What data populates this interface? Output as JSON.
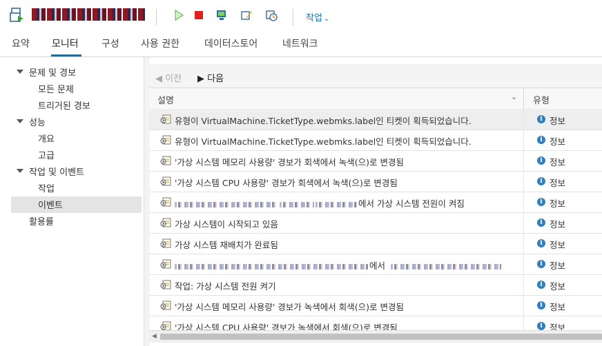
{
  "toolbar": {
    "vm_icon": "vm-power-icon",
    "icons": [
      "play-icon",
      "stop-icon",
      "console-icon",
      "edit-settings-icon",
      "snapshot-icon"
    ],
    "actions_label": "작업"
  },
  "tabs": [
    {
      "label": "요약"
    },
    {
      "label": "모니터"
    },
    {
      "label": "구성"
    },
    {
      "label": "사용 권한"
    },
    {
      "label": "데이터스토어"
    },
    {
      "label": "네트워크"
    }
  ],
  "active_tab": "모니터",
  "sidebar": {
    "groups": [
      {
        "label": "문제 및 경보",
        "items": [
          "모든 문제",
          "트리거된 경보"
        ]
      },
      {
        "label": "성능",
        "items": [
          "개요",
          "고급"
        ]
      },
      {
        "label": "작업 및 이벤트",
        "items": [
          "작업",
          "이벤트"
        ]
      }
    ],
    "standalone": "활용률",
    "selected": "이벤트"
  },
  "pager": {
    "prev_label": "이전",
    "next_label": "다음"
  },
  "table": {
    "columns": [
      "설명",
      "유형"
    ],
    "rows": [
      {
        "desc": "유형이 VirtualMachine.TicketType.webmks.label인 티켓이 획득되었습니다.",
        "type": "정보"
      },
      {
        "desc": "유형이 VirtualMachine.TicketType.webmks.label인 티켓이 획득되었습니다.",
        "type": "정보"
      },
      {
        "desc": "'가상 시스템 메모리 사용량' 경보가 회색에서 녹색(으)로 변경됨",
        "type": "정보"
      },
      {
        "desc": "'가상 시스템 CPU 사용량' 경보가 회색에서 녹색(으)로 변경됨",
        "type": "정보"
      },
      {
        "desc": "에서 가상 시스템 전원이 켜짐",
        "type": "정보"
      },
      {
        "desc": "가상 시스템이 시작되고 있음",
        "type": "정보"
      },
      {
        "desc": "가상 시스템 재배치가 완료됨",
        "type": "정보"
      },
      {
        "desc": "에서",
        "type": "정보"
      },
      {
        "desc": "작업: 가상 시스템 전원 켜기",
        "type": "정보"
      },
      {
        "desc": "'가상 시스템 메모리 사용량' 경보가 녹색에서 회색(으)로 변경됨",
        "type": "정보"
      },
      {
        "desc": "'가상 시스템 CPU 사용량' 경보가 녹색에서 회색(으)로 변경됨",
        "type": "정보"
      }
    ]
  },
  "colors": {
    "accent": "#0079b8",
    "info": "#2f7fc1",
    "stop": "#e02020",
    "play": "#5cb85c"
  }
}
